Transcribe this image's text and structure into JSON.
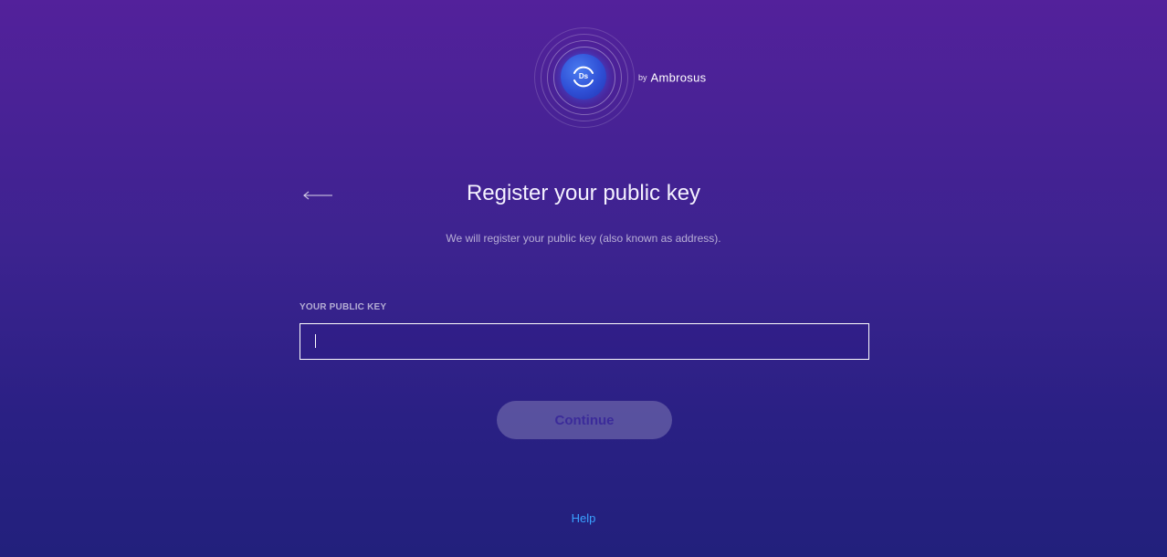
{
  "header": {
    "logo_letters": "Ds",
    "by": "by",
    "brand": "Ambrosus"
  },
  "main": {
    "title": "Register your public key",
    "subtitle": "We will register your public key (also known as address).",
    "field_label": "YOUR PUBLIC KEY",
    "input_value": "",
    "input_placeholder": "",
    "continue_label": "Continue"
  },
  "footer": {
    "help_label": "Help"
  },
  "icons": {
    "back": "arrow-left-icon",
    "logo": "dashboard-logo-icon"
  },
  "colors": {
    "background_top": "#53219b",
    "background_bottom": "#22207c",
    "help_link": "#3aa1ff",
    "logo_blue": "#2f4fd6"
  }
}
